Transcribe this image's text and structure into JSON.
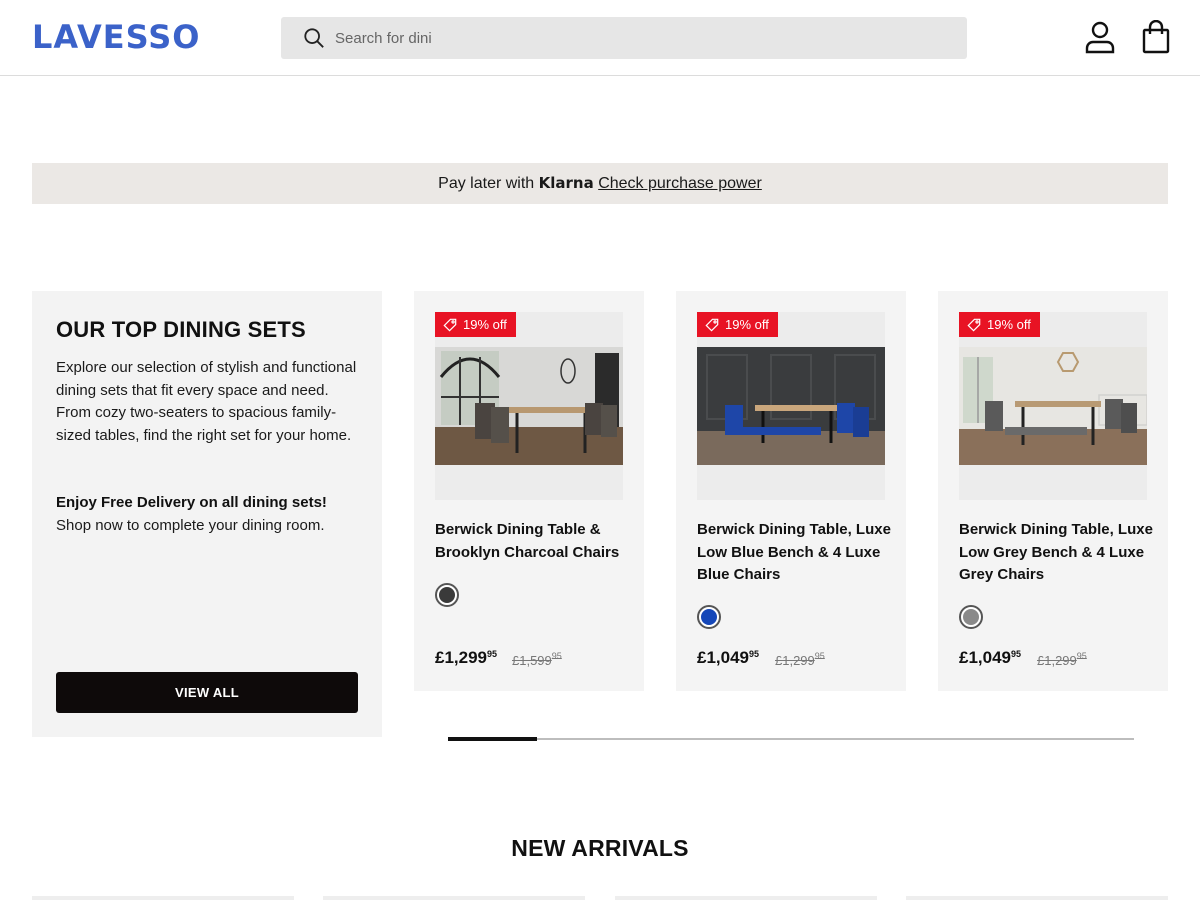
{
  "header": {
    "logo": "LAVESSO",
    "search_placeholder": "Search for dini"
  },
  "klarna": {
    "prefix": "Pay later with ",
    "brand": "Klarna",
    "link": "Check purchase power"
  },
  "promo": {
    "title": "OUR TOP DINING SETS",
    "description": "Explore our selection of stylish and functional dining sets that fit every space and need. From cozy two-seaters to spacious family-sized tables, find the right set for your home.",
    "highlight": "Enjoy Free Delivery on all dining sets!",
    "subtext": "Shop now to complete your dining room.",
    "button": "VIEW ALL"
  },
  "products": [
    {
      "badge": "19% off",
      "title": "Berwick Dining Table & Brooklyn Charcoal Chairs",
      "swatch_color": "#3a3a3a",
      "price_main": "£1,299",
      "price_pence": "95",
      "was_main": "£1,599",
      "was_pence": "95"
    },
    {
      "badge": "19% off",
      "title": "Berwick Dining Table, Luxe Low Blue Bench & 4 Luxe Blue Chairs",
      "swatch_color": "#1547b8",
      "price_main": "£1,049",
      "price_pence": "95",
      "was_main": "£1,299",
      "was_pence": "95"
    },
    {
      "badge": "19% off",
      "title": "Berwick Dining Table, Luxe Low Grey Bench & 4 Luxe Grey Chairs",
      "swatch_color": "#8a8a8a",
      "price_main": "£1,049",
      "price_pence": "95",
      "was_main": "£1,299",
      "was_pence": "95"
    }
  ],
  "carousel": {
    "progress": 0.13
  },
  "new_arrivals": {
    "title": "NEW ARRIVALS"
  },
  "colors": {
    "brand": "#3b62c9",
    "sale_badge": "#e81324",
    "button": "#0e0a0a"
  },
  "icons": [
    "search-icon",
    "account-icon",
    "shopping-bag-icon",
    "price-tag-icon"
  ]
}
